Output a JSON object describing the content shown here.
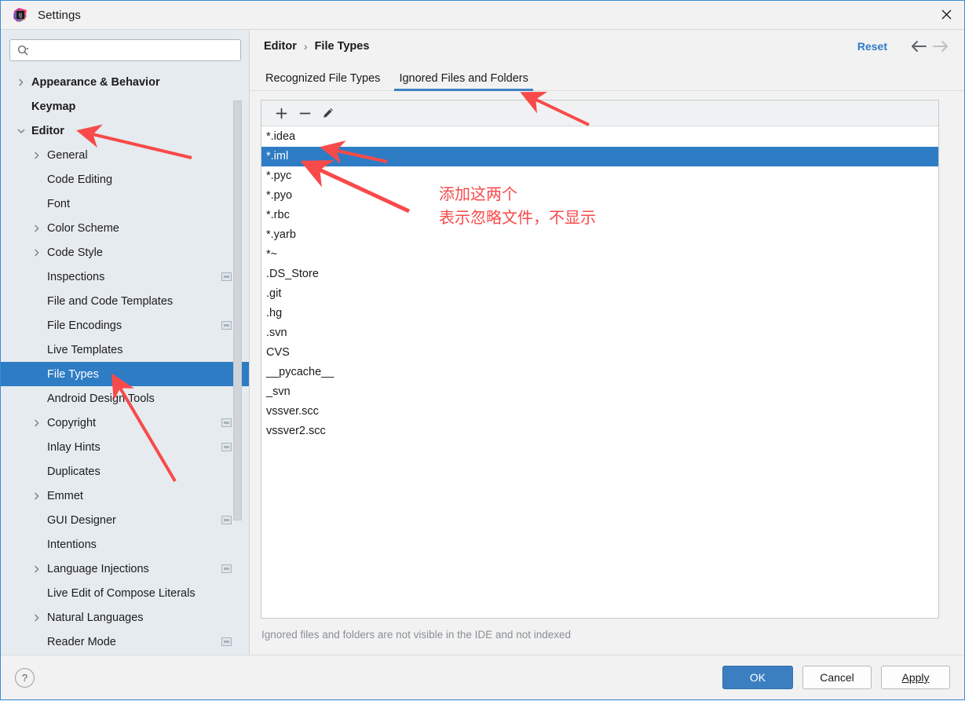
{
  "window": {
    "title": "Settings",
    "app_icon": "intellij-idea-icon",
    "close_icon": "close-icon"
  },
  "search": {
    "value": "",
    "placeholder": "",
    "icon": "search-icon"
  },
  "sidebar": {
    "items": [
      {
        "label": "Appearance & Behavior",
        "indent": 0,
        "arrow": "chevron-right",
        "bold": true,
        "badge": false,
        "selected": false
      },
      {
        "label": "Keymap",
        "indent": 0,
        "arrow": "none",
        "bold": true,
        "badge": false,
        "selected": false
      },
      {
        "label": "Editor",
        "indent": 0,
        "arrow": "chevron-down",
        "bold": true,
        "badge": false,
        "selected": false
      },
      {
        "label": "General",
        "indent": 1,
        "arrow": "chevron-right",
        "bold": false,
        "badge": false,
        "selected": false
      },
      {
        "label": "Code Editing",
        "indent": 1,
        "arrow": "none",
        "bold": false,
        "badge": false,
        "selected": false
      },
      {
        "label": "Font",
        "indent": 1,
        "arrow": "none",
        "bold": false,
        "badge": false,
        "selected": false
      },
      {
        "label": "Color Scheme",
        "indent": 1,
        "arrow": "chevron-right",
        "bold": false,
        "badge": false,
        "selected": false
      },
      {
        "label": "Code Style",
        "indent": 1,
        "arrow": "chevron-right",
        "bold": false,
        "badge": false,
        "selected": false
      },
      {
        "label": "Inspections",
        "indent": 1,
        "arrow": "none",
        "bold": false,
        "badge": true,
        "selected": false
      },
      {
        "label": "File and Code Templates",
        "indent": 1,
        "arrow": "none",
        "bold": false,
        "badge": false,
        "selected": false
      },
      {
        "label": "File Encodings",
        "indent": 1,
        "arrow": "none",
        "bold": false,
        "badge": true,
        "selected": false
      },
      {
        "label": "Live Templates",
        "indent": 1,
        "arrow": "none",
        "bold": false,
        "badge": false,
        "selected": false
      },
      {
        "label": "File Types",
        "indent": 1,
        "arrow": "none",
        "bold": false,
        "badge": false,
        "selected": true
      },
      {
        "label": "Android Design Tools",
        "indent": 1,
        "arrow": "none",
        "bold": false,
        "badge": false,
        "selected": false
      },
      {
        "label": "Copyright",
        "indent": 1,
        "arrow": "chevron-right",
        "bold": false,
        "badge": true,
        "selected": false
      },
      {
        "label": "Inlay Hints",
        "indent": 1,
        "arrow": "none",
        "bold": false,
        "badge": true,
        "selected": false
      },
      {
        "label": "Duplicates",
        "indent": 1,
        "arrow": "none",
        "bold": false,
        "badge": false,
        "selected": false
      },
      {
        "label": "Emmet",
        "indent": 1,
        "arrow": "chevron-right",
        "bold": false,
        "badge": false,
        "selected": false
      },
      {
        "label": "GUI Designer",
        "indent": 1,
        "arrow": "none",
        "bold": false,
        "badge": true,
        "selected": false
      },
      {
        "label": "Intentions",
        "indent": 1,
        "arrow": "none",
        "bold": false,
        "badge": false,
        "selected": false
      },
      {
        "label": "Language Injections",
        "indent": 1,
        "arrow": "chevron-right",
        "bold": false,
        "badge": true,
        "selected": false
      },
      {
        "label": "Live Edit of Compose Literals",
        "indent": 1,
        "arrow": "none",
        "bold": false,
        "badge": false,
        "selected": false
      },
      {
        "label": "Natural Languages",
        "indent": 1,
        "arrow": "chevron-right",
        "bold": false,
        "badge": false,
        "selected": false
      },
      {
        "label": "Reader Mode",
        "indent": 1,
        "arrow": "none",
        "bold": false,
        "badge": true,
        "selected": false
      }
    ]
  },
  "breadcrumb": {
    "parent": "Editor",
    "separator": "›",
    "current": "File Types"
  },
  "header_actions": {
    "reset_label": "Reset",
    "back_icon": "arrow-left-icon",
    "forward_icon": "arrow-right-icon"
  },
  "tabs": [
    {
      "label": "Recognized File Types",
      "active": false
    },
    {
      "label": "Ignored Files and Folders",
      "active": true
    }
  ],
  "list_toolbar": {
    "add_icon": "plus-icon",
    "remove_icon": "minus-icon",
    "edit_icon": "pencil-icon"
  },
  "ignored_list": [
    {
      "value": "*.idea",
      "selected": false
    },
    {
      "value": "*.iml",
      "selected": true
    },
    {
      "value": "*.pyc",
      "selected": false
    },
    {
      "value": "*.pyo",
      "selected": false
    },
    {
      "value": "*.rbc",
      "selected": false
    },
    {
      "value": "*.yarb",
      "selected": false
    },
    {
      "value": "*~",
      "selected": false
    },
    {
      "value": ".DS_Store",
      "selected": false
    },
    {
      "value": ".git",
      "selected": false
    },
    {
      "value": ".hg",
      "selected": false
    },
    {
      "value": ".svn",
      "selected": false
    },
    {
      "value": "CVS",
      "selected": false
    },
    {
      "value": "__pycache__",
      "selected": false
    },
    {
      "value": "_svn",
      "selected": false
    },
    {
      "value": "vssver.scc",
      "selected": false
    },
    {
      "value": "vssver2.scc",
      "selected": false
    }
  ],
  "hint": "Ignored files and folders are not visible in the IDE and not indexed",
  "footer": {
    "help_icon": "question-mark-icon",
    "ok_label": "OK",
    "cancel_label": "Cancel",
    "apply_label": "Apply"
  },
  "annotations": {
    "color": "#f84a4a",
    "line1": "添加这两个",
    "line2": "表示忽略文件，不显示"
  },
  "colors": {
    "accent_blue": "#2d7cc4",
    "link_blue": "#2e7ac4",
    "sidebar_bg": "#e6ebef",
    "panel_bg": "#f2f2f2",
    "annotation_red": "#f84a4a"
  }
}
